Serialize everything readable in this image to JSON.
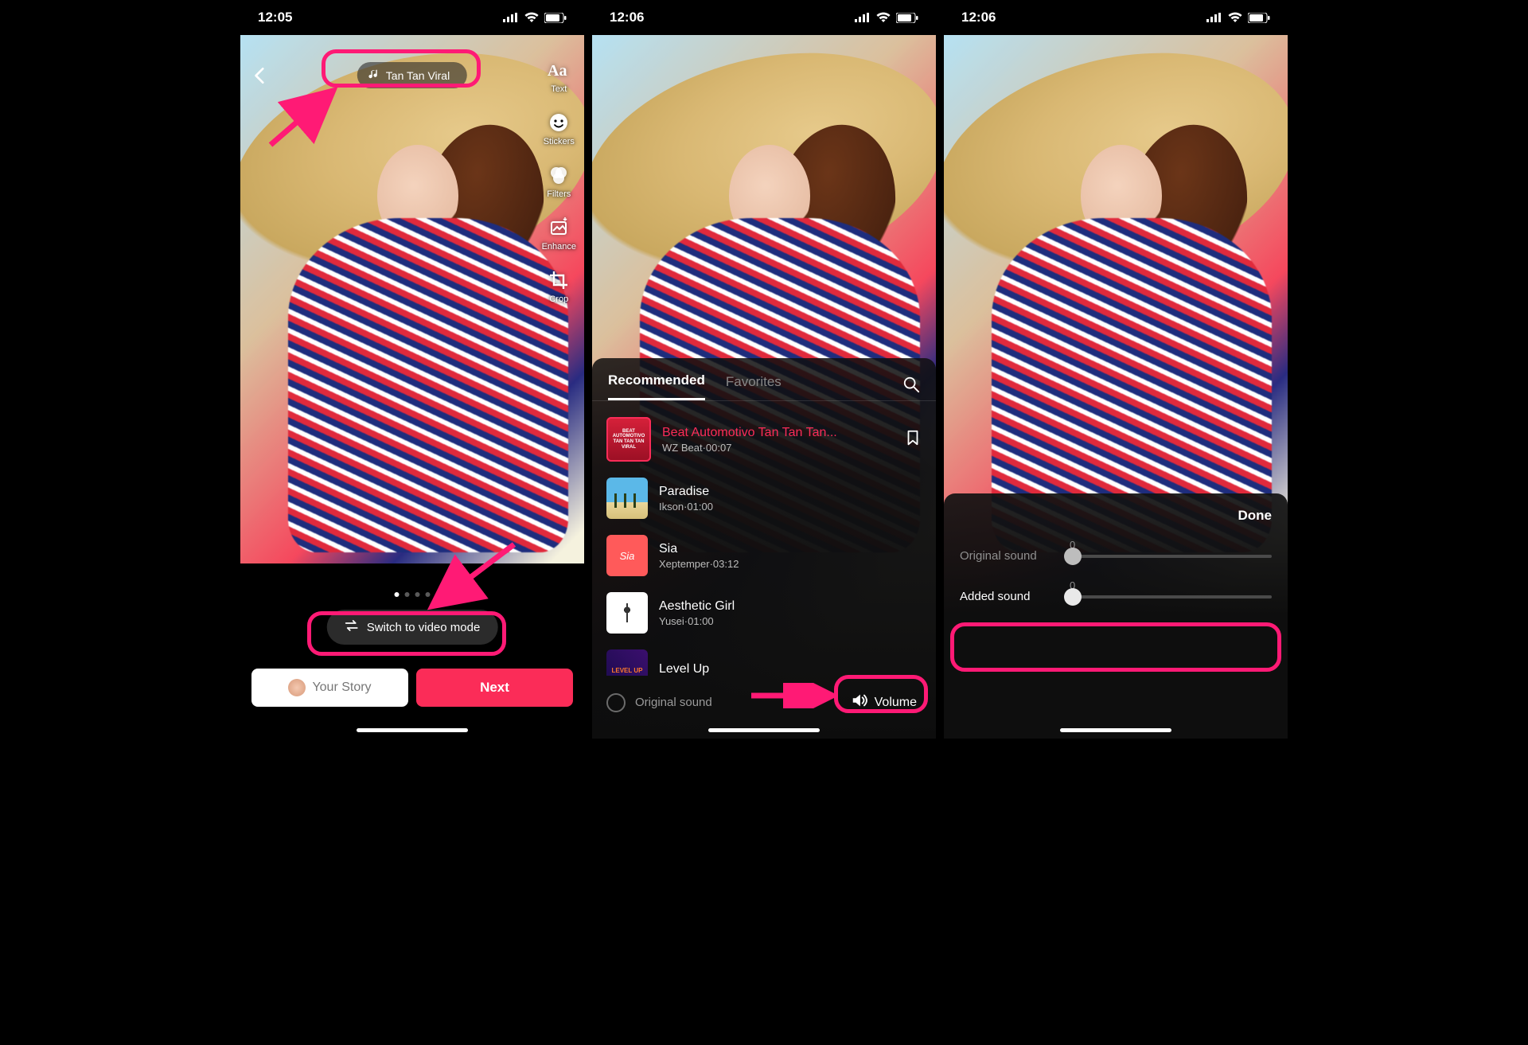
{
  "status": {
    "times": [
      "12:05",
      "12:06",
      "12:06"
    ]
  },
  "phone1": {
    "sound_name": "Tan Tan Viral",
    "tools": {
      "text": "Text",
      "stickers": "Stickers",
      "filters": "Filters",
      "enhance": "Enhance",
      "crop": "Crop"
    },
    "switch_label": "Switch to video mode",
    "your_story": "Your Story",
    "next": "Next"
  },
  "phone2": {
    "tabs": {
      "recommended": "Recommended",
      "favorites": "Favorites"
    },
    "tracks": [
      {
        "name": "Beat Automotivo Tan Tan Tan...",
        "meta": "WZ Beat·00:07",
        "selected": true,
        "cover_text": "BEAT AUTOMOTIVO TAN TAN TAN VIRAL"
      },
      {
        "name": "Paradise",
        "meta": "Ikson·01:00",
        "selected": false,
        "cover_text": ""
      },
      {
        "name": "Sia",
        "meta": "Xeptemper·03:12",
        "selected": false,
        "cover_text": "Sia"
      },
      {
        "name": "Aesthetic Girl",
        "meta": "Yusei·01:00",
        "selected": false,
        "cover_text": ""
      },
      {
        "name": "Level Up",
        "meta": "",
        "selected": false,
        "cover_text": "LEVEL UP"
      }
    ],
    "original_sound": "Original sound",
    "volume": "Volume"
  },
  "phone3": {
    "done": "Done",
    "sliders": {
      "original_label": "Original sound",
      "original_value": "0",
      "added_label": "Added sound",
      "added_value": "0"
    }
  }
}
